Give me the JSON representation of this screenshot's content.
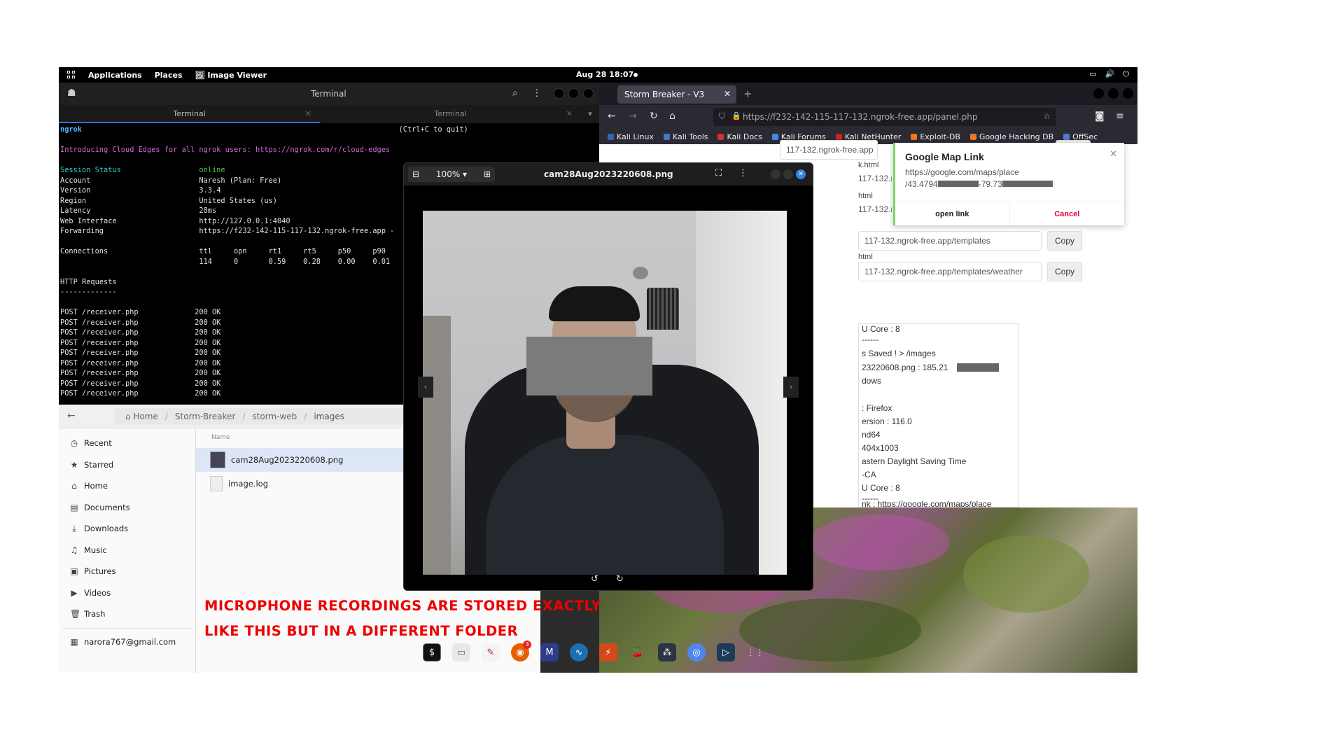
{
  "topbar": {
    "applications": "Applications",
    "places": "Places",
    "active_app": "Image Viewer",
    "clock": "Aug 28  18:07"
  },
  "terminal": {
    "title": "Terminal",
    "tabs": [
      "Terminal",
      "Terminal"
    ],
    "lines": {
      "ngrok": "ngrok",
      "quit": "(Ctrl+C to quit)",
      "intro": "Introducing Cloud Edges for all ngrok users: https://ngrok.com/r/cloud-edges",
      "session_label": "Session Status",
      "session_value": "online",
      "account_label": "Account",
      "account_value": "Naresh (Plan: Free)",
      "version_label": "Version",
      "version_value": "3.3.4",
      "region_label": "Region",
      "region_value": "United States (us)",
      "latency_label": "Latency",
      "latency_value": "28ms",
      "web_label": "Web Interface",
      "web_value": "http://127.0.0.1:4040",
      "fwd_label": "Forwarding",
      "fwd_value": "https://f232-142-115-117-132.ngrok-free.app -",
      "conn_label": "Connections",
      "conn_headers": "ttl     opn     rt1     rt5     p50     p90",
      "conn_values": "114     0       0.59    0.28    0.00    0.01",
      "http_title": "HTTP Requests",
      "http_rule": "-------------",
      "requests": [
        "POST /receiver.php             200 OK",
        "POST /receiver.php             200 OK",
        "POST /receiver.php             200 OK",
        "POST /receiver.php             200 OK",
        "POST /receiver.php             200 OK",
        "POST /receiver.php             200 OK",
        "POST /receiver.php             200 OK",
        "POST /receiver.php             200 OK",
        "POST /receiver.php             200 OK"
      ]
    }
  },
  "files": {
    "breadcrumb": [
      "Home",
      "Storm-Breaker",
      "storm-web",
      "images"
    ],
    "sidebar": [
      "Recent",
      "Starred",
      "Home",
      "Documents",
      "Downloads",
      "Music",
      "Pictures",
      "Videos",
      "Trash"
    ],
    "account": "narora767@gmail.com",
    "column_name": "Name",
    "items": [
      "cam28Aug2023220608.png",
      "image.log"
    ]
  },
  "caption": {
    "line1": "Microphone recordings are stored exactly",
    "line2": "like this but in a different folder"
  },
  "browser": {
    "tab_title": "Storm Breaker - V3",
    "url": "https://f232-142-115-117-132.ngrok-free.app/panel.php",
    "bookmarks": [
      "Kali Linux",
      "Kali Tools",
      "Kali Docs",
      "Kali Forums",
      "Kali NetHunter",
      "Exploit-DB",
      "Google Hacking DB",
      "OffSec"
    ],
    "fields": [
      "117-132.ngrok-free.app",
      "117-132.ngrok-free.app",
      "117-132.ngrok-free.app",
      "117-132.ngrok-free.app/templates",
      "117-132.ngrok-free.app/templates/weather"
    ],
    "subs": [
      "k.html",
      "html",
      "html"
    ],
    "copy": "Copy",
    "info": [
      "U Core :  8",
      "------",
      "s Saved ! > /images",
      "23220608.png : 185.21",
      "dows",
      ": Firefox",
      "ersion : 116.0",
      "nd64",
      "404x1003",
      "astern Daylight Saving Time",
      "-CA",
      "U Core :  8",
      "------",
      "nk : https://google.com/maps/place"
    ],
    "popup": {
      "title": "Google Map Link",
      "line1": "https://google.com/maps/place",
      "line2": "/43.4794",
      "line2b": "-79.73",
      "open": "open link",
      "cancel": "Cancel"
    }
  },
  "viewer": {
    "zoom": "100%",
    "filename": "cam28Aug2023220608.png"
  },
  "dock": {
    "badge": "3"
  },
  "colors": {
    "caption": "#ee0000",
    "accent_blue": "#3584e4"
  }
}
